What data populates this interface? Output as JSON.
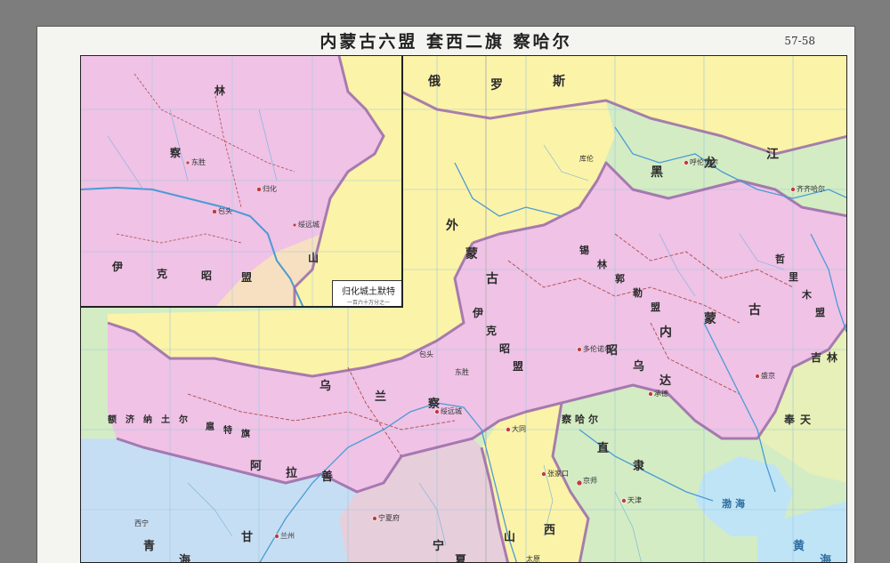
{
  "page": {
    "title": "内蒙古六盟 套西二旗 察哈尔",
    "page_number": "57-58"
  },
  "colors": {
    "background_gray": "#7d7d7d",
    "paper": "#f4f4f0",
    "mongolia_pink": "#efc2e6",
    "yellow_region": "#fbf3a8",
    "green_region": "#d3ecc4",
    "blue_region": "#c6def3",
    "water": "#bfe4f6",
    "border_purple": "#9a6aa8",
    "river_blue": "#4a9bd4"
  },
  "inset": {
    "title": "归化城土默特",
    "scale_note": "一百六十万分之一"
  },
  "labels": {
    "russia_1": "俄",
    "russia_2": "罗",
    "russia_3": "斯",
    "outer_1": "外",
    "outer_2": "蒙",
    "outer_3": "古",
    "mongol_black_dragon": "黑",
    "mongol_long": "龙",
    "mongol_jiang": "江",
    "neimeng_1": "内",
    "neimeng_2": "蒙",
    "neimeng_3": "古",
    "zhaowuda_1": "昭",
    "zhaowuda_2": "乌",
    "zhaowuda_3": "达",
    "wulanchabu_1": "乌",
    "wulanchabu_2": "兰",
    "wulanchabu_3": "察",
    "alashan_1": "阿",
    "alashan_2": "拉",
    "alashan_3": "善",
    "ejina_1": "额",
    "ejina_2": "济",
    "ejina_3": "纳",
    "ejina_4": "土",
    "ejina_5": "尔",
    "ejina_6": "扈",
    "ejina_7": "特",
    "ejina_8": "旗",
    "ningxia_1": "宁",
    "ningxia_2": "夏",
    "gansu_1": "甘",
    "qinghai_1": "青",
    "qinghai_2": "海",
    "shanxi_1": "山",
    "shanxi_2": "西",
    "zhili_1": "直",
    "zhili_2": "隶",
    "ili_yikezhao_1": "伊",
    "ili_yikezhao_2": "克",
    "ili_yikezhao_3": "昭",
    "ili_yikezhao_4": "盟",
    "xilin_1": "锡",
    "xilin_2": "林",
    "xilin_3": "郭",
    "xilin_4": "勒",
    "xilin_5": "盟",
    "zhelimu_1": "哲",
    "zhelimu_2": "里",
    "zhelimu_3": "木",
    "zhelimu_4": "盟",
    "fengtian": "奉天",
    "jilin": "吉林",
    "chahar": "察哈尔",
    "bohai": "渤海",
    "yellow_sea_1": "黄",
    "yellow_sea_2": "海",
    "dongsheng": "东胜",
    "suiyuan": "绥远城",
    "baotou": "包头",
    "guihua": "归化",
    "zhangjiakou": "张家口",
    "dolon": "多伦诺尔",
    "chengde": "承德",
    "shenyang": "盛京",
    "hulun": "呼伦贝尔",
    "qiqihar": "齐齐哈尔",
    "taiyuan": "太原",
    "lanzhou": "兰州",
    "yinchuan": "宁夏府",
    "xining": "西宁",
    "beijing": "京师",
    "tianjin": "天津",
    "datong": "大同",
    "kuche": "库伦"
  }
}
